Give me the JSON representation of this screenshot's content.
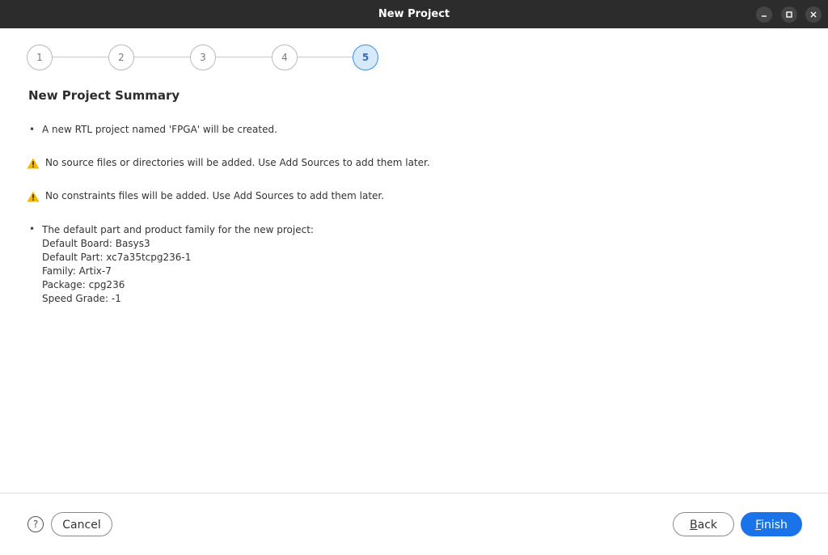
{
  "window": {
    "title": "New Project"
  },
  "stepper": {
    "steps": [
      "1",
      "2",
      "3",
      "4",
      "5"
    ],
    "active_index": 4
  },
  "page": {
    "title": "New Project Summary",
    "items": [
      {
        "kind": "bullet",
        "text": "A new RTL project named 'FPGA' will be created."
      },
      {
        "kind": "warning",
        "text": "No source files or directories will be added. Use Add Sources to add them later."
      },
      {
        "kind": "warning",
        "text": "No constraints files will be added. Use Add Sources to add them later."
      }
    ],
    "part_summary": {
      "heading": "The default part and product family for the new project:",
      "board": "Default Board: Basys3",
      "part": "Default Part: xc7a35tcpg236-1",
      "family": "Family: Artix-7",
      "package": "Package: cpg236",
      "speed_grade": "Speed Grade: -1"
    }
  },
  "footer": {
    "help_label": "?",
    "cancel_label": "Cancel",
    "back_first": "B",
    "back_rest": "ack",
    "finish_first": "F",
    "finish_rest": "inish"
  },
  "colors": {
    "accent": "#1a73e8",
    "warning": "#f2b705",
    "titlebar": "#2c2c2c"
  }
}
